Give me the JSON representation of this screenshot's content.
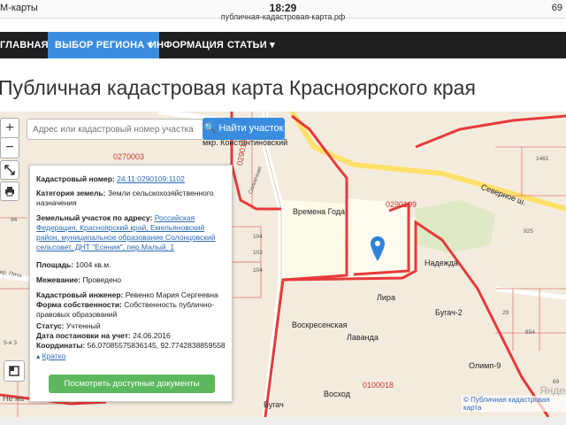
{
  "status_bar": {
    "carrier": "М-карты",
    "time": "18:29",
    "url": "публичная-кадастровая-карта.рф",
    "battery": "69"
  },
  "nav": {
    "items": [
      "ГЛАВНАЯ",
      "ВЫБОР РЕГИОНА ▾",
      "ИНФОРМАЦИЯ",
      "СТАТЬИ ▾"
    ]
  },
  "page_title": "Публичная кадастровая карта Красноярского края",
  "search": {
    "placeholder": "Адрес или кадастровый номер участка",
    "button_label": "Найти участок"
  },
  "map_controls": {
    "zoom_in": "+",
    "zoom_out": "−"
  },
  "info": {
    "cadastral_number_label": "Кадастровый номер:",
    "cadastral_number": "24:11:0290109:1102",
    "land_category_label": "Категория земель:",
    "land_category": "Земли сельскохозяйственного назначения",
    "address_label": "Земельный участок по адресу:",
    "address": "Российская Федерация, Красноярский край, Емельяновский район, муниципальное образование Солонцовский сельсовет, ДНТ \"Есения\", пер.Малый, 1",
    "area_label": "Площадь:",
    "area": "1004 кв.м.",
    "survey_label": "Межевание:",
    "survey": "Проведено",
    "engineer_label": "Кадастровый инженер:",
    "engineer": "Ревенко Мария Сергеевна",
    "ownership_label": "Форма собственности:",
    "ownership": "Собственность публично-правовых образований",
    "status_label": "Статус:",
    "status": "Учтенный",
    "registered_label": "Дата постановки на учет:",
    "registered": "24.06.2016",
    "coords_label": "Координаты:",
    "coords": "56.07085575836145, 92.7742838859558",
    "brief_link": "Кратко",
    "docs_button": "Посмотреть доступные документы"
  },
  "map_labels": {
    "district": "мкр. Константиновский",
    "vremena_goda": "Времена Года",
    "nadezhda": "Надежда",
    "lira": "Лира",
    "voskresenskaya": "Воскресенская",
    "lavanda": "Лаванда",
    "bugach2": "Бугач-2",
    "olimp": "Олимп-9",
    "voskhod": "Восход",
    "bugach": "Бугач",
    "severnoe": "Северное ш.",
    "solnechnaya": "Солнечная",
    "cad_0270003": "0270003",
    "cad_0290104": "0290104",
    "cad_0290109": "0290109",
    "cad_0100018": "0100018",
    "num_1461": "1461",
    "num_94": "94",
    "num_104a": "104",
    "num_104b": "104",
    "num_102": "102",
    "num_925": "925",
    "num_854": "854",
    "num_29": "29",
    "num_69": "69",
    "left_cut_1": "ер. Пятн",
    "left_cut_2": "5-я З",
    "left_cut_3": "Не на",
    "yandex": "Яндекс",
    "attribution": "© Публичная кадастровая карта"
  },
  "colors": {
    "nav_bg": "#1f1f1f",
    "accent": "#3a8dde",
    "boundary": "#e8393b",
    "docs_button": "#5cb85c"
  }
}
